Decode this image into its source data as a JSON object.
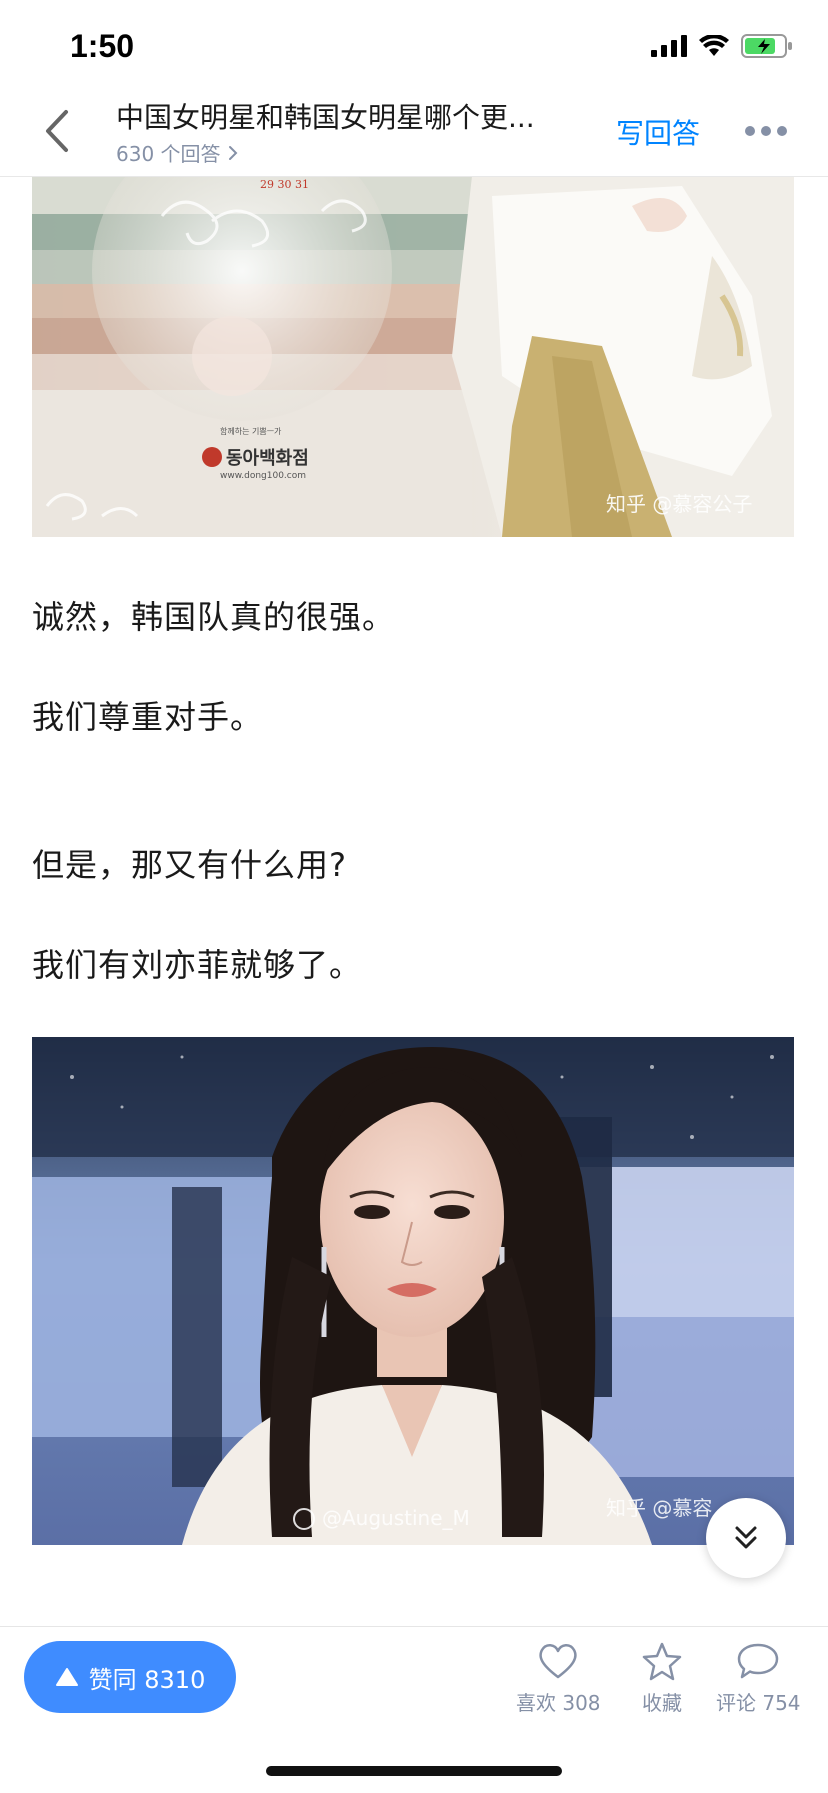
{
  "status_bar": {
    "time": "1:50"
  },
  "header": {
    "title": "中国女明星和韩国女明星哪个更...",
    "answer_count": "630 个回答",
    "write_answer": "写回答"
  },
  "content": {
    "image1": {
      "calendar_dates": "29   30   31",
      "brand_small": "함께하는 기쁨ㅡ가",
      "brand_name": "동아백화점",
      "brand_url": "www.dong100.com",
      "watermark": "知乎 @慕容公子"
    },
    "paragraphs": [
      "诚然，韩国队真的很强。",
      "我们尊重对手。",
      "但是，那又有什么用?",
      "我们有刘亦菲就够了。"
    ],
    "image2": {
      "weibo_watermark": "@Augustine_M",
      "zhihu_watermark": "知乎 @慕容"
    }
  },
  "bottom_bar": {
    "vote_label": "赞同 8310",
    "like_label": "喜欢 308",
    "collect_label": "收藏",
    "comment_label": "评论 754"
  },
  "colors": {
    "accent": "#0084ff",
    "vote_button": "#3f8cff",
    "muted_text": "#8590a6"
  },
  "icons": [
    "back-chevron-icon",
    "more-dots-icon",
    "signal-icon",
    "wifi-icon",
    "battery-icon",
    "scroll-down-icon",
    "heart-icon",
    "star-icon",
    "comment-bubble-icon",
    "upvote-triangle-icon"
  ]
}
